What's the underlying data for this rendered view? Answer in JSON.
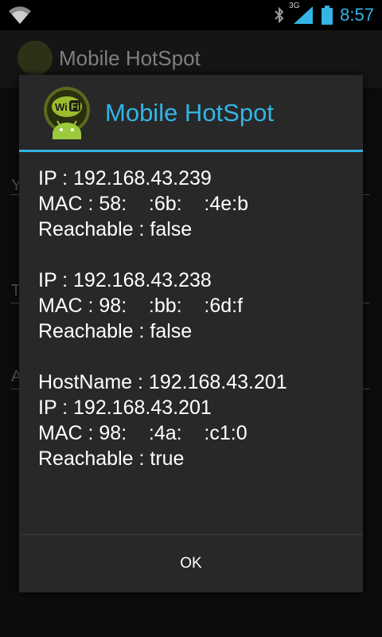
{
  "status_bar": {
    "time": "8:57",
    "network_type": "3G",
    "icons": [
      "wifi-hotspot-icon",
      "bluetooth-icon",
      "signal-icon",
      "battery-icon"
    ]
  },
  "app_bar": {
    "title": "Mobile HotSpot"
  },
  "background": {
    "letters": [
      "Y",
      "T",
      "A"
    ]
  },
  "dialog": {
    "title": "Mobile HotSpot",
    "devices": [
      {
        "lines": [
          "IP : 192.168.43.239",
          "MAC : 58:    :6b:    :4e:b",
          "Reachable : false"
        ]
      },
      {
        "lines": [
          "IP : 192.168.43.238",
          "MAC : 98:    :bb:    :6d:f",
          "Reachable : false"
        ]
      },
      {
        "lines": [
          "HostName : 192.168.43.201",
          "IP : 192.168.43.201",
          "MAC : 98:    :4a:    :c1:0",
          "Reachable : true"
        ]
      }
    ],
    "ok_label": "OK"
  },
  "colors": {
    "accent": "#33b5e5",
    "dialog_bg": "#282828",
    "text": "#ffffff"
  }
}
